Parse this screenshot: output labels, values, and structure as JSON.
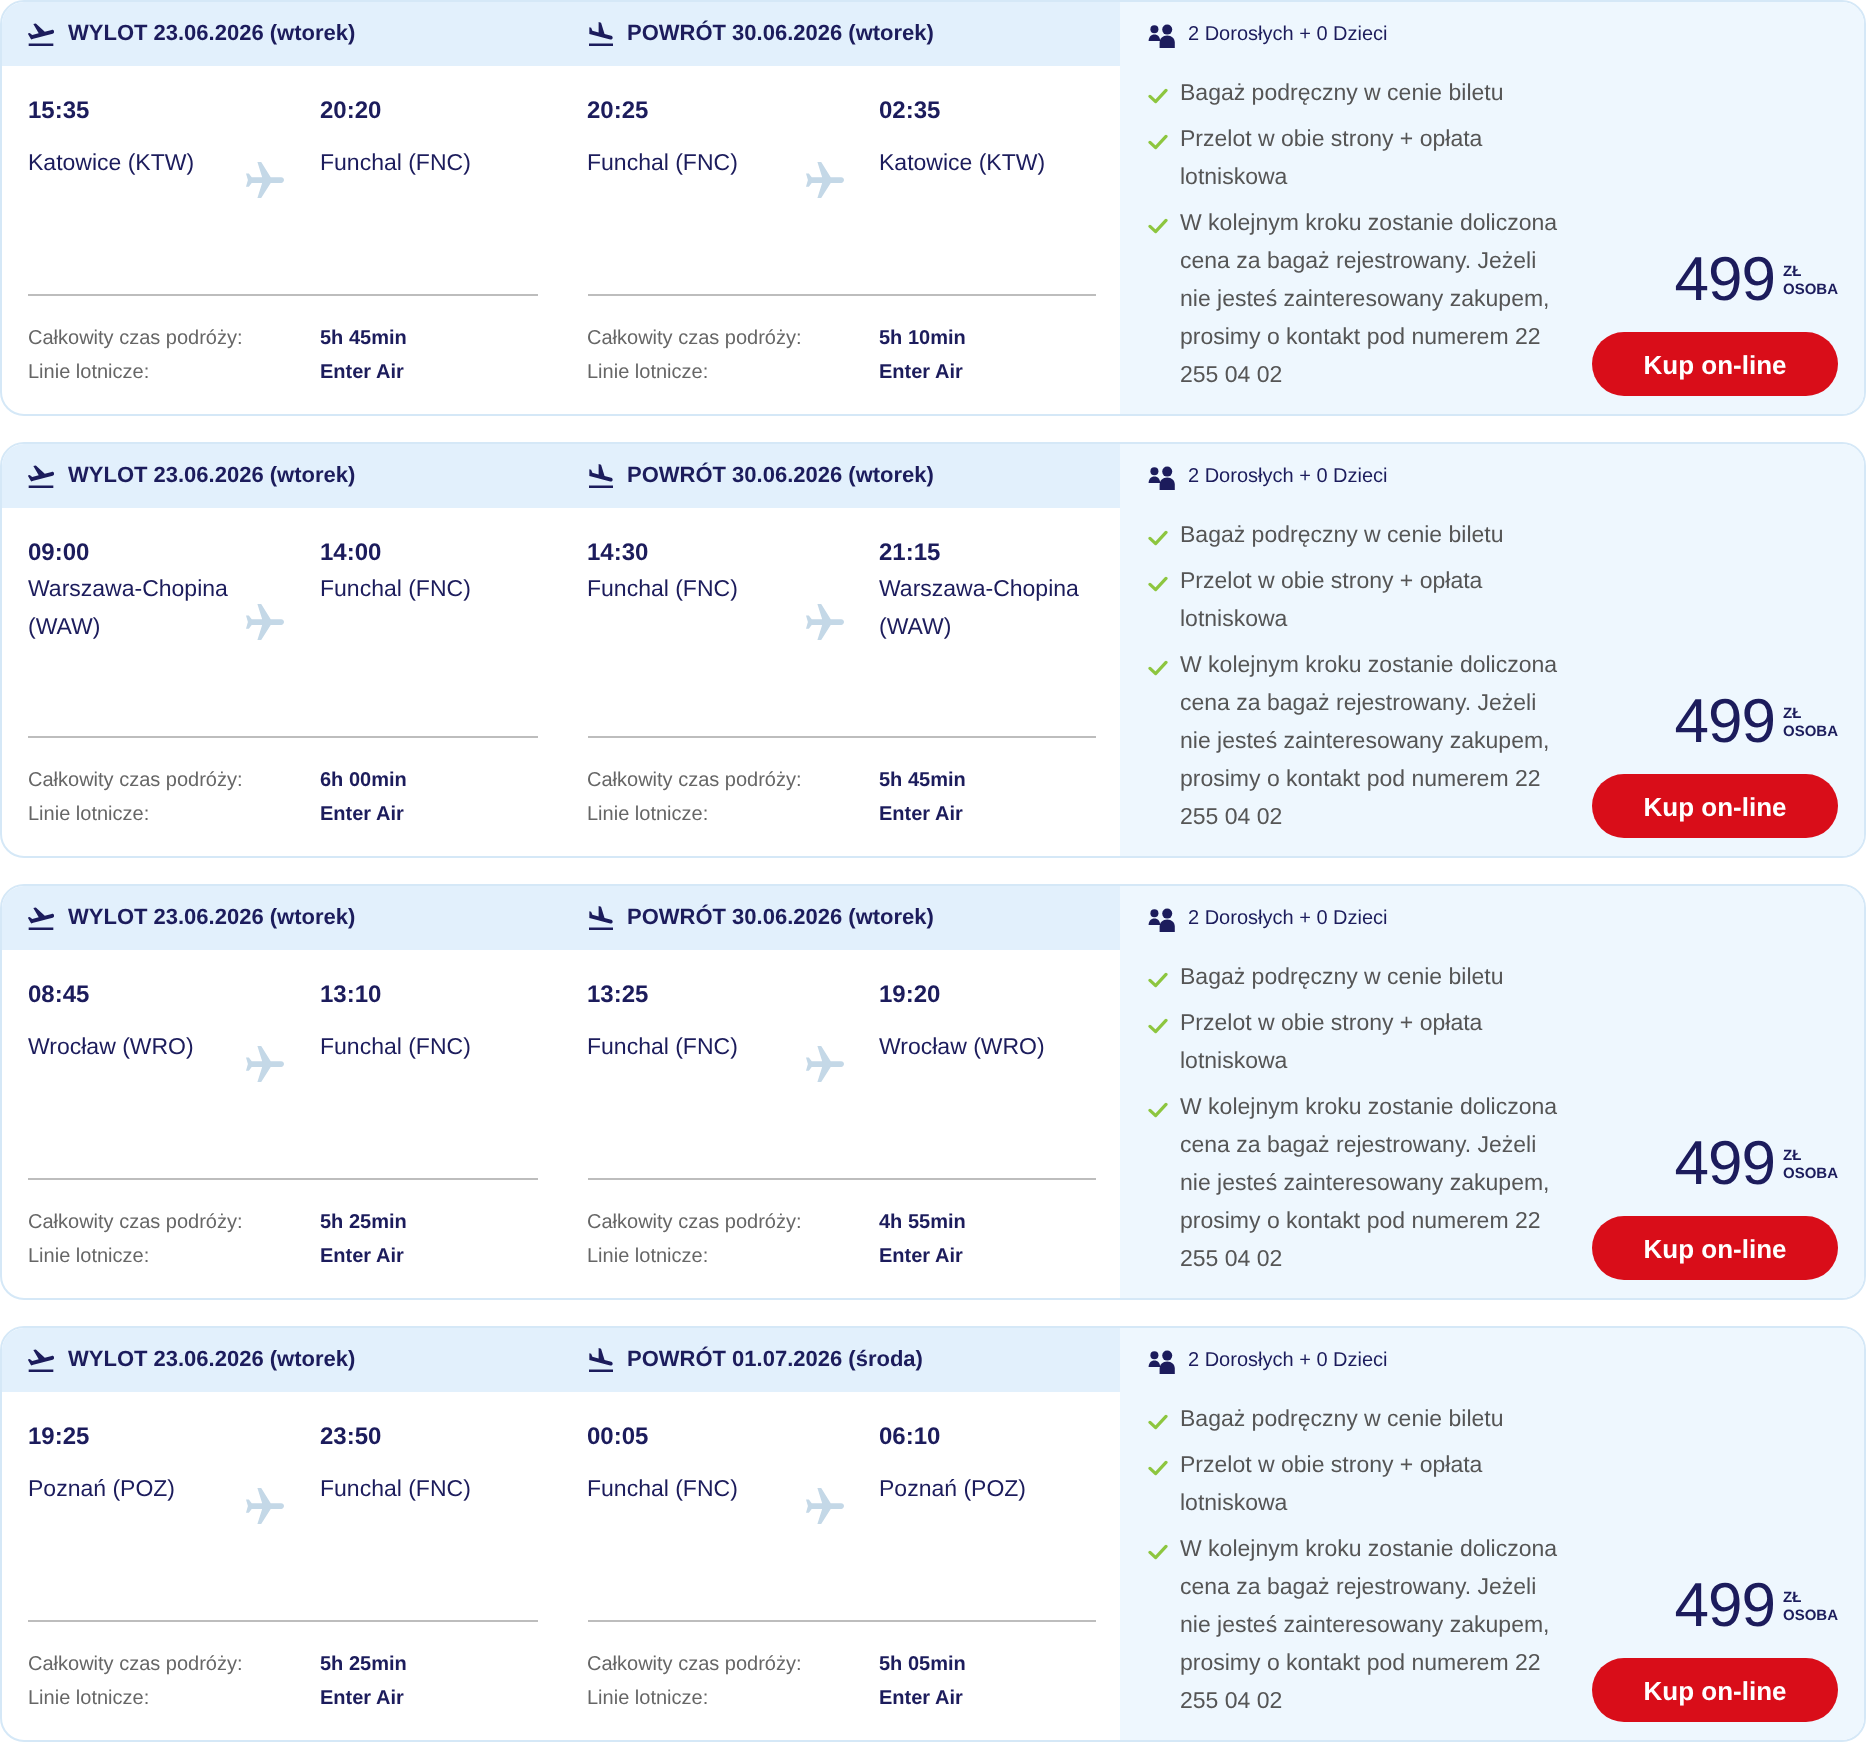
{
  "offers": [
    {
      "legs": [
        {
          "kind": "departure",
          "title": "WYLOT 23.06.2026 (wtorek)",
          "from": {
            "time": "15:35",
            "place": "Katowice (KTW)"
          },
          "to": {
            "time": "20:20",
            "place": "Funchal (FNC)"
          },
          "details": [
            {
              "label": "Całkowity czas podróży:",
              "value": "5h 45min"
            },
            {
              "label": "Linie lotnicze:",
              "value": "Enter Air"
            }
          ]
        },
        {
          "kind": "return",
          "title": "POWRÓT 30.06.2026 (wtorek)",
          "from": {
            "time": "20:25",
            "place": "Funchal (FNC)"
          },
          "to": {
            "time": "02:35",
            "place": "Katowice (KTW)"
          },
          "details": [
            {
              "label": "Całkowity czas podróży:",
              "value": "5h 10min"
            },
            {
              "label": "Linie lotnicze:",
              "value": "Enter Air"
            }
          ]
        }
      ],
      "passengers": "2 Dorosłych + 0 Dzieci",
      "features": [
        "Bagaż podręczny w cenie biletu",
        "Przelot w obie strony + opłata lotniskowa",
        "W kolejnym kroku zostanie doliczona cena za bagaż rejestrowany. Jeżeli nie jesteś zainteresowany zakupem, prosimy o kontakt pod numerem 22 255 04 02"
      ],
      "price": "499",
      "currency": "ZŁ",
      "per": "OSOBA",
      "button": "Kup on-line"
    },
    {
      "legs": [
        {
          "kind": "departure",
          "title": "WYLOT 23.06.2026 (wtorek)",
          "from": {
            "time": "09:00",
            "place": "Warszawa-Chopina (WAW)"
          },
          "to": {
            "time": "14:00",
            "place": "Funchal (FNC)"
          },
          "details": [
            {
              "label": "Całkowity czas podróży:",
              "value": "6h 00min"
            },
            {
              "label": "Linie lotnicze:",
              "value": "Enter Air"
            }
          ]
        },
        {
          "kind": "return",
          "title": "POWRÓT 30.06.2026 (wtorek)",
          "from": {
            "time": "14:30",
            "place": "Funchal (FNC)"
          },
          "to": {
            "time": "21:15",
            "place": "Warszawa-Chopina (WAW)"
          },
          "details": [
            {
              "label": "Całkowity czas podróży:",
              "value": "5h 45min"
            },
            {
              "label": "Linie lotnicze:",
              "value": "Enter Air"
            }
          ]
        }
      ],
      "passengers": "2 Dorosłych + 0 Dzieci",
      "features": [
        "Bagaż podręczny w cenie biletu",
        "Przelot w obie strony + opłata lotniskowa",
        "W kolejnym kroku zostanie doliczona cena za bagaż rejestrowany. Jeżeli nie jesteś zainteresowany zakupem, prosimy o kontakt pod numerem 22 255 04 02"
      ],
      "price": "499",
      "currency": "ZŁ",
      "per": "OSOBA",
      "button": "Kup on-line"
    },
    {
      "legs": [
        {
          "kind": "departure",
          "title": "WYLOT 23.06.2026 (wtorek)",
          "from": {
            "time": "08:45",
            "place": "Wrocław (WRO)"
          },
          "to": {
            "time": "13:10",
            "place": "Funchal (FNC)"
          },
          "details": [
            {
              "label": "Całkowity czas podróży:",
              "value": "5h 25min"
            },
            {
              "label": "Linie lotnicze:",
              "value": "Enter Air"
            }
          ]
        },
        {
          "kind": "return",
          "title": "POWRÓT 30.06.2026 (wtorek)",
          "from": {
            "time": "13:25",
            "place": "Funchal (FNC)"
          },
          "to": {
            "time": "19:20",
            "place": "Wrocław (WRO)"
          },
          "details": [
            {
              "label": "Całkowity czas podróży:",
              "value": "4h 55min"
            },
            {
              "label": "Linie lotnicze:",
              "value": "Enter Air"
            }
          ]
        }
      ],
      "passengers": "2 Dorosłych + 0 Dzieci",
      "features": [
        "Bagaż podręczny w cenie biletu",
        "Przelot w obie strony + opłata lotniskowa",
        "W kolejnym kroku zostanie doliczona cena za bagaż rejestrowany. Jeżeli nie jesteś zainteresowany zakupem, prosimy o kontakt pod numerem 22 255 04 02"
      ],
      "price": "499",
      "currency": "ZŁ",
      "per": "OSOBA",
      "button": "Kup on-line"
    },
    {
      "legs": [
        {
          "kind": "departure",
          "title": "WYLOT 23.06.2026 (wtorek)",
          "from": {
            "time": "19:25",
            "place": "Poznań (POZ)"
          },
          "to": {
            "time": "23:50",
            "place": "Funchal (FNC)"
          },
          "details": [
            {
              "label": "Całkowity czas podróży:",
              "value": "5h 25min"
            },
            {
              "label": "Linie lotnicze:",
              "value": "Enter Air"
            }
          ]
        },
        {
          "kind": "return",
          "title": "POWRÓT 01.07.2026 (środa)",
          "from": {
            "time": "00:05",
            "place": "Funchal (FNC)"
          },
          "to": {
            "time": "06:10",
            "place": "Poznań (POZ)"
          },
          "details": [
            {
              "label": "Całkowity czas podróży:",
              "value": "5h 05min"
            },
            {
              "label": "Linie lotnicze:",
              "value": "Enter Air"
            }
          ]
        }
      ],
      "passengers": "2 Dorosłych + 0 Dzieci",
      "features": [
        "Bagaż podręczny w cenie biletu",
        "Przelot w obie strony + opłata lotniskowa",
        "W kolejnym kroku zostanie doliczona cena za bagaż rejestrowany. Jeżeli nie jesteś zainteresowany zakupem, prosimy o kontakt pod numerem 22 255 04 02"
      ],
      "price": "499",
      "currency": "ZŁ",
      "per": "OSOBA",
      "button": "Kup on-line"
    }
  ]
}
